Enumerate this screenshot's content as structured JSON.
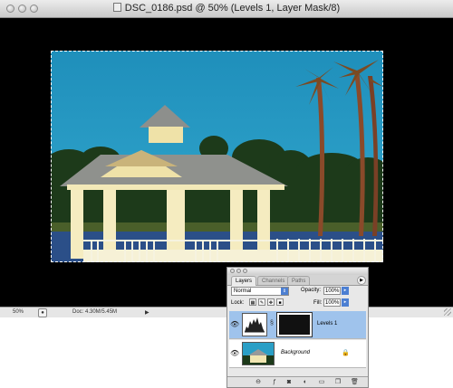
{
  "window": {
    "title": "DSC_0186.psd @ 50% (Levels 1, Layer Mask/8)"
  },
  "status_bar": {
    "zoom": "50%",
    "doc_info": "Doc: 4.30M/5.45M",
    "arrow": "▶"
  },
  "layers_palette": {
    "tabs": [
      "Layers",
      "Channels",
      "Paths"
    ],
    "active_tab": "Layers",
    "blend_mode": "Normal",
    "opacity_label": "Opacity:",
    "opacity_value": "100%",
    "lock_label": "Lock:",
    "fill_label": "Fill:",
    "fill_value": "100%",
    "layers": [
      {
        "name": "Levels 1",
        "selected": true,
        "visible": true,
        "type": "adjustment-levels-with-mask"
      },
      {
        "name": "Background",
        "selected": false,
        "visible": true,
        "locked": true,
        "type": "image"
      }
    ],
    "bottom_icons": [
      "link-icon",
      "layer-style-icon",
      "add-mask-icon",
      "adjustment-layer-icon",
      "new-group-icon",
      "new-layer-icon",
      "trash-icon"
    ]
  },
  "colors": {
    "sky": "#2a9fc6",
    "selected_layer": "#9fc3ec",
    "accent": "#4c7fd2"
  }
}
